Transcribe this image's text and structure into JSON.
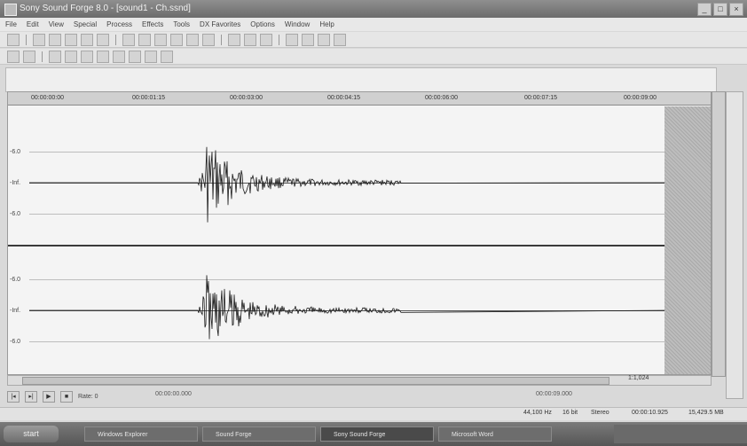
{
  "window": {
    "title": "Sony Sound Forge 8.0 - [sound1 - Ch.ssnd]"
  },
  "menu": [
    "File",
    "Edit",
    "View",
    "Special",
    "Process",
    "Effects",
    "Tools",
    "DX Favorites",
    "Options",
    "Window",
    "Help"
  ],
  "ruler": {
    "ticks": [
      "00:00:00:00",
      "00:00:01:15",
      "00:00:03:00",
      "00:00:04:15",
      "00:00:06:00",
      "00:00:07:15",
      "00:00:09:00"
    ]
  },
  "channels": {
    "top_labels": [
      "-6.0",
      "-Inf.",
      "-6.0"
    ],
    "bottom_labels": [
      "-6.0",
      "-Inf.",
      "-6.0"
    ]
  },
  "zoom": "1:1,024",
  "transport": {
    "rate_label": "Rate: 0"
  },
  "positions": {
    "cursor": "00:00:00.000",
    "selection_start": "00:00:09.000"
  },
  "status": {
    "format": "44,100 Hz",
    "bits": "16 bit",
    "channels": "Stereo",
    "length": "00:00:10.925",
    "free": "15,429.5 MB"
  },
  "taskbar": {
    "start": "start",
    "tasks": [
      "Windows Explorer",
      "Sound Forge",
      "Sony Sound Forge",
      "Microsoft Word"
    ]
  },
  "icons": [
    "app-icon",
    "minimize-icon",
    "maximize-icon",
    "close-icon",
    "play-icon",
    "stop-icon",
    "record-icon",
    "loop-icon",
    "rewind-icon",
    "forward-icon"
  ]
}
